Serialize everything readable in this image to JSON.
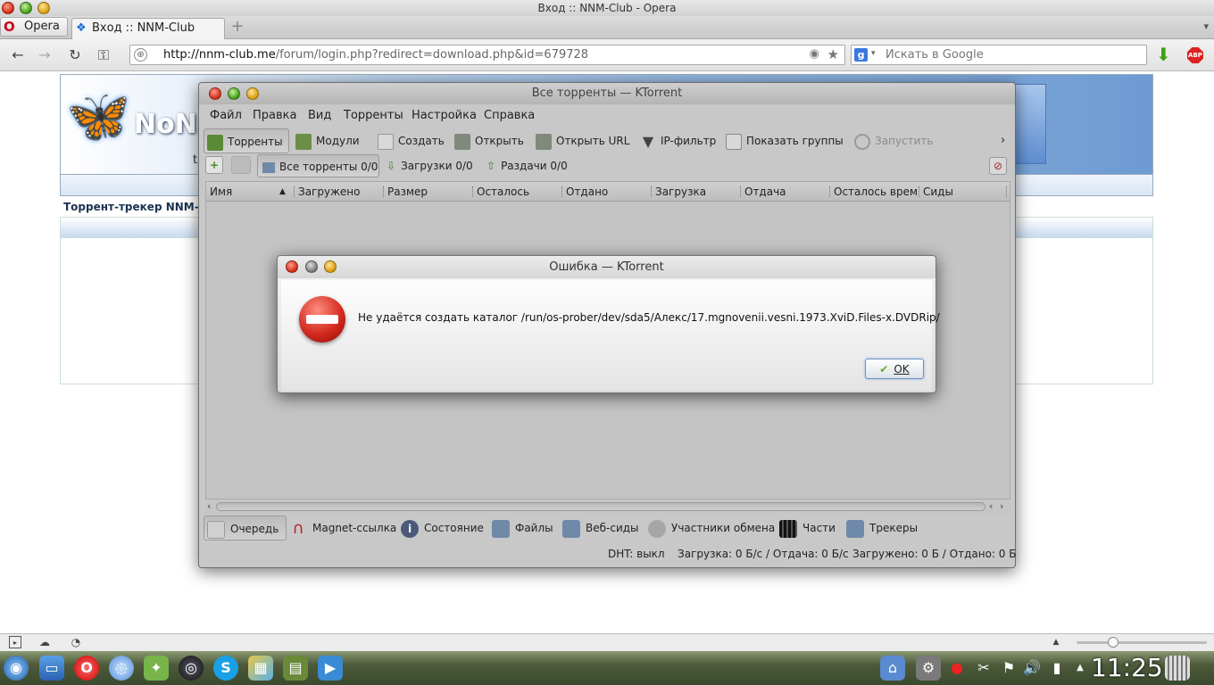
{
  "opera": {
    "window_title": "Вход :: NNM-Club - Opera",
    "menu_label": "Opera",
    "tab_title": "Вход :: NNM-Club",
    "url_host": "http://nnm-club.me",
    "url_path": "/forum/login.php?redirect=download.php&id=679728",
    "search_placeholder": "Искать в Google",
    "search_engine_letter": "g",
    "abp_label": "ABP"
  },
  "page": {
    "logo_text": "NoNa",
    "logo_sub": "t",
    "title": "Торрент-трекер NNM-Clu"
  },
  "ktorrent": {
    "window_title": "Все торренты — KTorrent",
    "menu": [
      "Файл",
      "Правка",
      "Вид",
      "Торренты",
      "Настройка",
      "Справка"
    ],
    "toolbar": {
      "torrents": "Торренты",
      "modules": "Модули",
      "create": "Создать",
      "open": "Открыть",
      "open_url": "Открыть URL",
      "ip_filter": "IP-фильтр",
      "show_groups": "Показать группы",
      "start": "Запустить",
      "more": "›"
    },
    "groups": {
      "all": "Все торренты 0/0",
      "downloads": "Загрузки 0/0",
      "seeds": "Раздачи 0/0"
    },
    "columns": [
      "Имя",
      "Загружено",
      "Размер",
      "Осталось",
      "Отдано",
      "Загрузка",
      "Отдача",
      "Осталось време",
      "Сиды"
    ],
    "bottom_tabs": {
      "queue": "Очередь",
      "magnet": "Magnet-ссылка",
      "status": "Состояние",
      "files": "Файлы",
      "webseeds": "Веб-сиды",
      "peers": "Участники обмена",
      "chunks": "Части",
      "trackers": "Трекеры"
    },
    "status": {
      "dht": "DHT: выкл",
      "speed": "Загрузка: 0 Б/с / Отдача: 0 Б/с",
      "totals": "Загружено: 0 Б / Отдано: 0 Б"
    }
  },
  "error_dialog": {
    "title": "Ошибка — KTorrent",
    "message": "Не удаётся создать каталог /run/os-prober/dev/sda5/Алекс/17.mgnovenii.vesni.1973.XviD.Files-x.DVDRip/",
    "ok_label": "OK"
  },
  "taskbar": {
    "clock": "11:25"
  },
  "colors": {
    "accent_error": "#d52b20",
    "ok_check": "#6aa820",
    "opera_red": "#d0021b"
  }
}
